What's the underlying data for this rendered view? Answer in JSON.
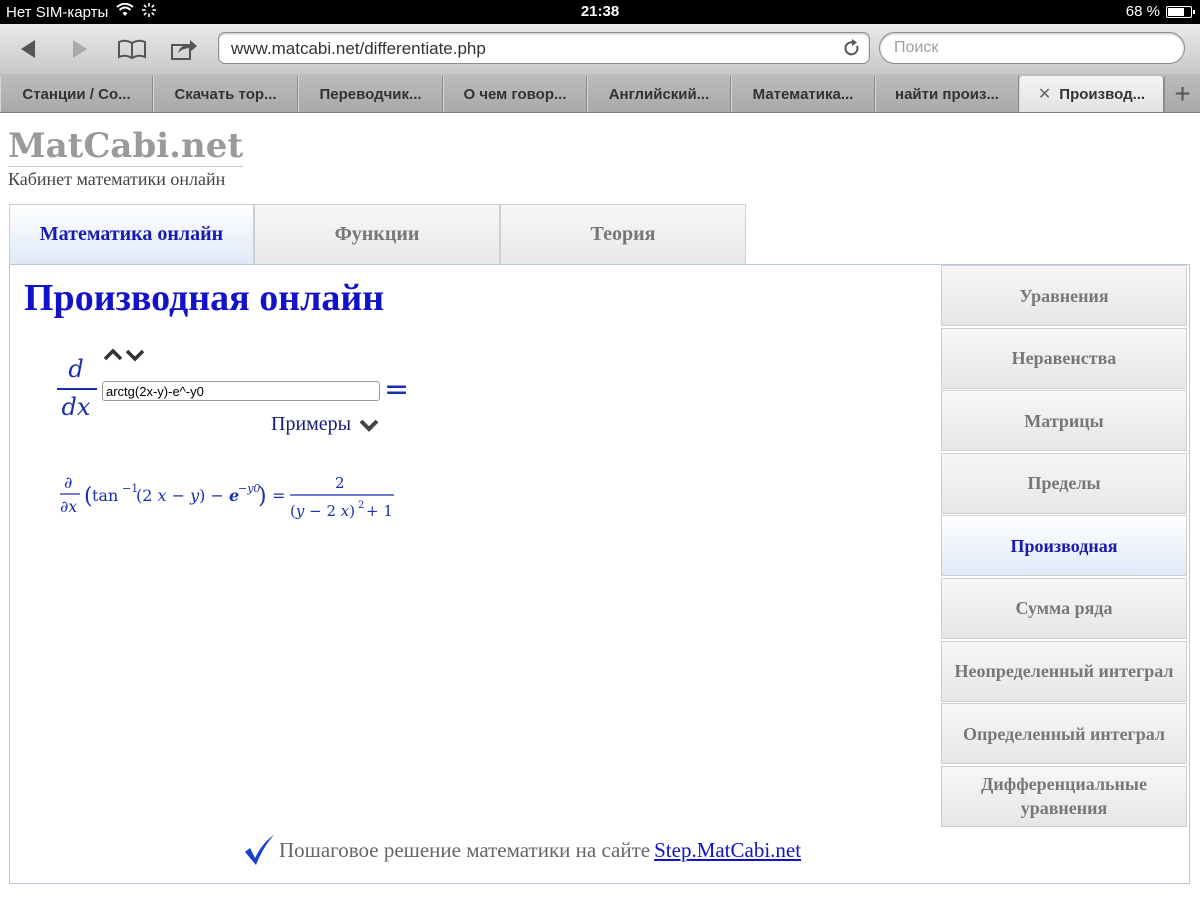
{
  "status_bar": {
    "carrier": "Нет SIM-карты",
    "time": "21:38",
    "battery": "68 %"
  },
  "browser": {
    "url": "www.matcabi.net/differentiate.php",
    "search_placeholder": "Поиск",
    "tabs": [
      {
        "label": "Станции / Со..."
      },
      {
        "label": "Скачать тор..."
      },
      {
        "label": "Переводчик..."
      },
      {
        "label": "О чем говор..."
      },
      {
        "label": "Английский..."
      },
      {
        "label": "Математика..."
      },
      {
        "label": "найти произ..."
      },
      {
        "label": "Производ..."
      }
    ],
    "new_tab": "+"
  },
  "site": {
    "logo": "MatCabi.net",
    "tagline": "Кабинет математики онлайн",
    "nav_tabs": [
      {
        "label": "Математика онлайн"
      },
      {
        "label": "Функции"
      },
      {
        "label": "Теория"
      }
    ],
    "page_title": "Производная онлайн",
    "derivative": {
      "numerator": "d",
      "denominator": "dx",
      "input_value": "arctg(2x-y)-e^-y0",
      "equals": "=",
      "examples_label": "Примеры"
    },
    "sidebar": [
      {
        "label": "Уравнения"
      },
      {
        "label": "Неравенства"
      },
      {
        "label": "Матрицы"
      },
      {
        "label": "Пределы"
      },
      {
        "label": "Производная"
      },
      {
        "label": "Сумма ряда"
      },
      {
        "label": "Неопределенный интеграл"
      },
      {
        "label": "Определенный интеграл"
      },
      {
        "label": "Дифференциальные уравнения"
      }
    ],
    "footer": {
      "text": "Пошаговое решение математики на сайте",
      "link": "Step.MatCabi.net"
    }
  }
}
